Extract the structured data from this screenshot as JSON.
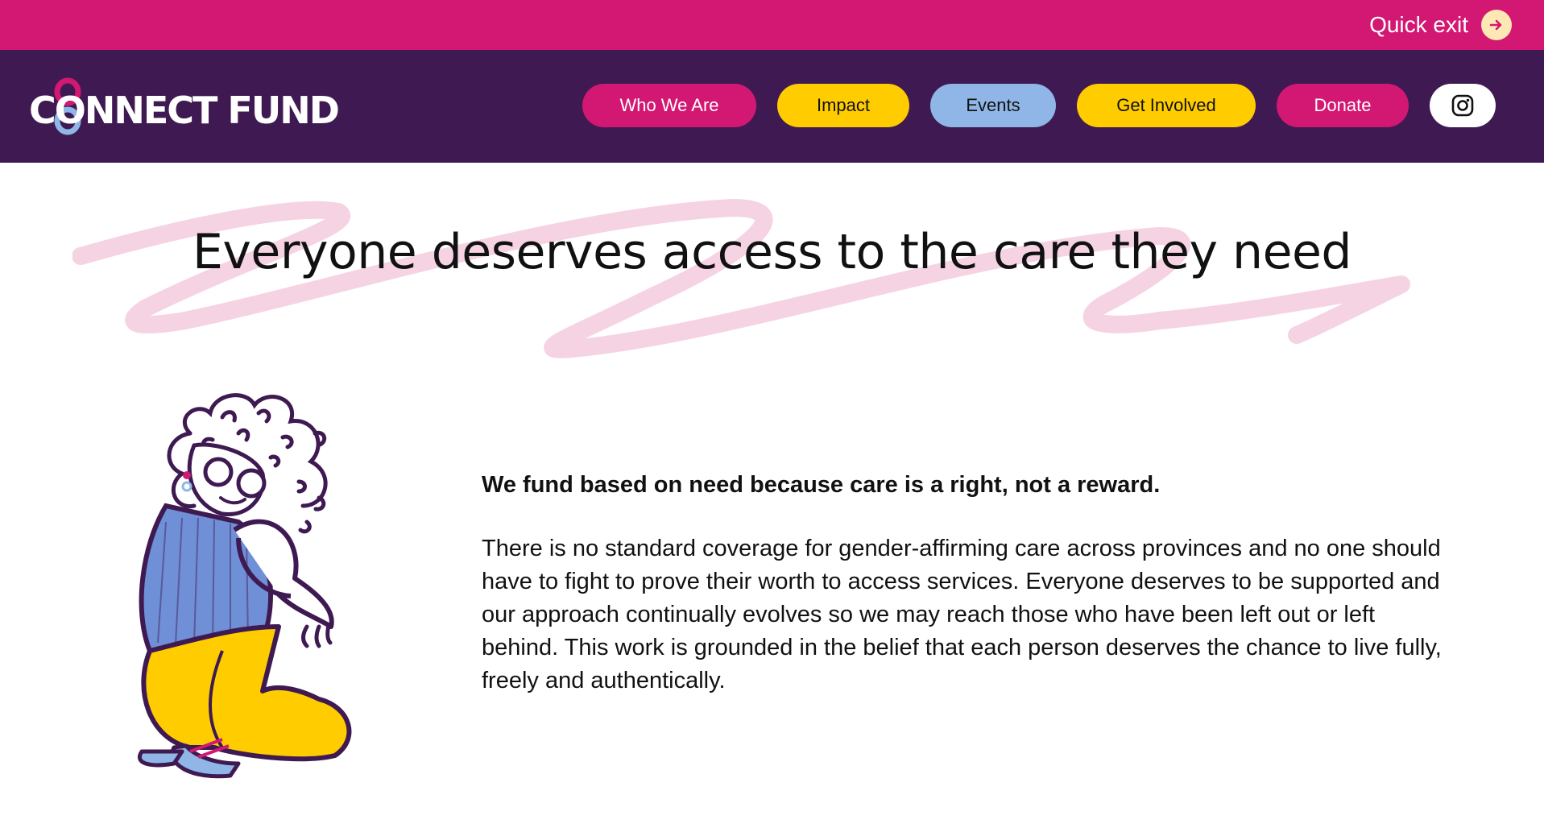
{
  "quick_exit": {
    "label": "Quick exit",
    "icon": "arrow-right-icon"
  },
  "logo": {
    "text": "CONNECT FUND"
  },
  "nav": {
    "items": [
      {
        "label": "Who We Are"
      },
      {
        "label": "Impact"
      },
      {
        "label": "Events"
      },
      {
        "label": "Get Involved"
      },
      {
        "label": "Donate"
      }
    ],
    "instagram_icon": "instagram-icon"
  },
  "hero": {
    "headline": "Everyone deserves access to the care they need"
  },
  "content": {
    "lead": "We fund based on need because care is a right, not a reward.",
    "body": "There is no standard coverage for gender-affirming care across provinces and no one should have to fight to prove their worth to access services. Everyone deserves to be supported and our approach continually evolves so we may reach those who have been left out or left behind. This work is grounded in the belief that each person deserves the chance to live fully, freely and authentically."
  },
  "colors": {
    "top_bar": "#d21873",
    "nav_bar": "#3f1a52",
    "pink": "#d21873",
    "yellow": "#ffcc00",
    "blue": "#8fb6e6",
    "scribble": "#f6d3e3"
  }
}
